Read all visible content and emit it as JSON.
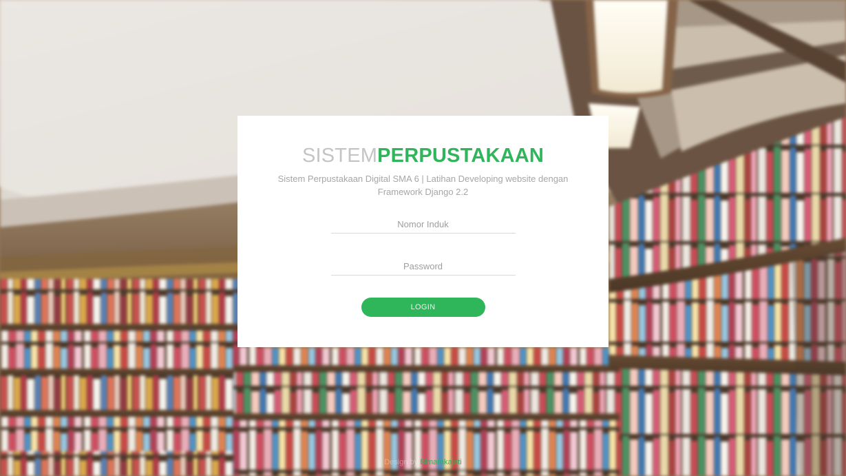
{
  "brand": {
    "part1": "SISTEM",
    "part2": "PERPUSTAKAAN"
  },
  "subtitle": "Sistem Perpustakaan Digital SMA 6 | Latihan Developing website dengan Framework Django 2.2",
  "form": {
    "username_placeholder": "Nomor Induk",
    "username_value": "",
    "password_placeholder": "Password",
    "password_value": "",
    "login_label": "LOGIN"
  },
  "footer": {
    "text": "Design by",
    "author": "Bimarakajati"
  },
  "colors": {
    "accent": "#2fb55a",
    "card": "#ffffff",
    "brand_muted": "#c4c4c4",
    "subtitle": "#a6a6a6"
  },
  "background": {
    "scene": "library-bookshelves"
  }
}
